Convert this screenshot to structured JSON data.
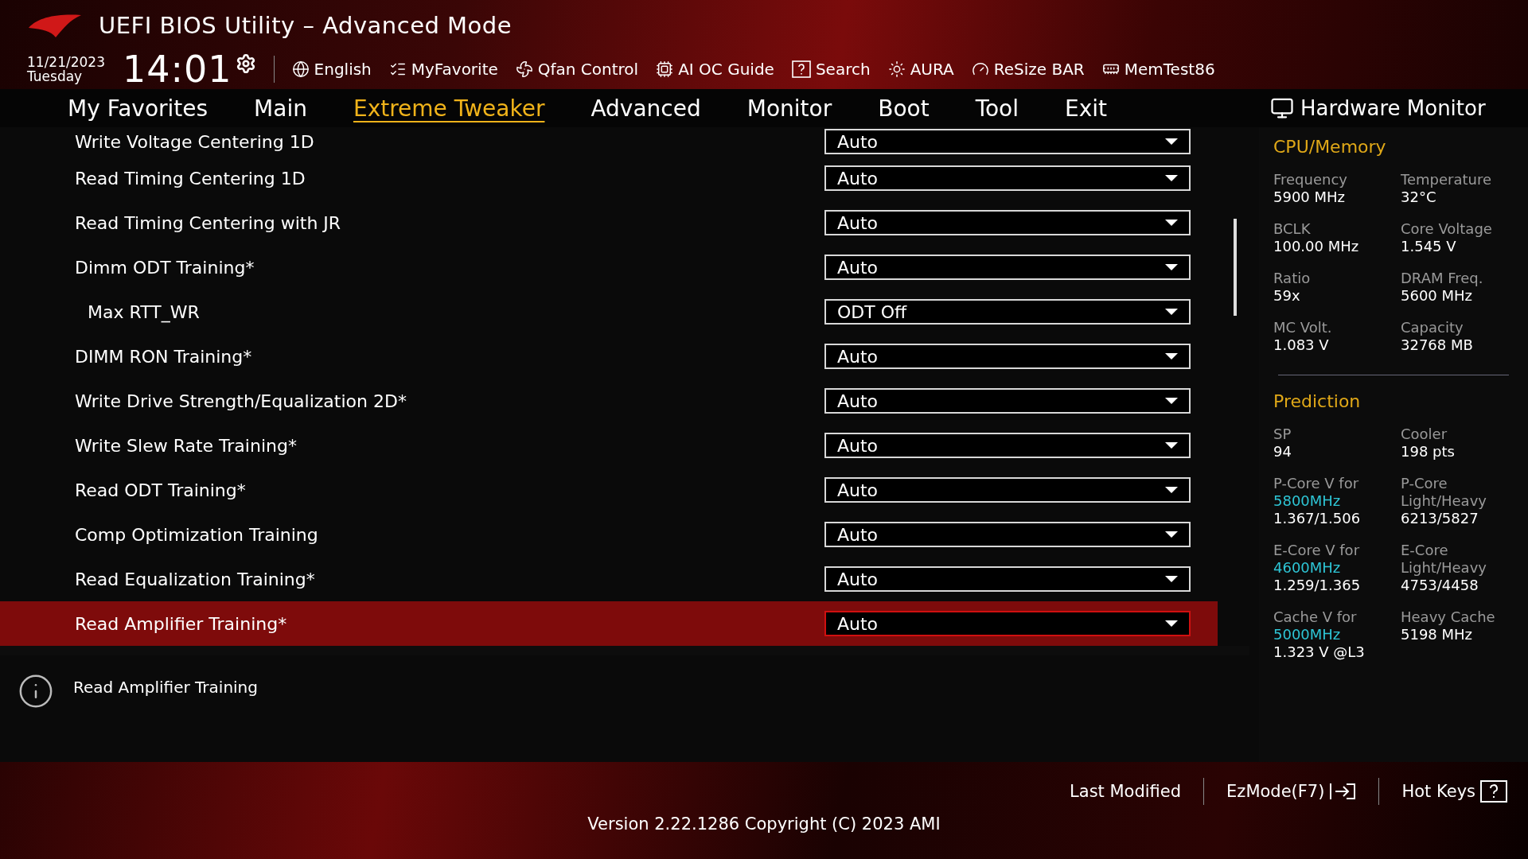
{
  "header": {
    "title": "UEFI BIOS Utility – Advanced Mode",
    "date": "11/21/2023",
    "day": "Tuesday",
    "time": "14:01",
    "tools": [
      {
        "kind": "language",
        "label": "English"
      },
      {
        "kind": "favorite",
        "label": "MyFavorite"
      },
      {
        "kind": "fan",
        "label": "Qfan Control"
      },
      {
        "kind": "guide",
        "label": "AI OC Guide"
      },
      {
        "kind": "search",
        "label": "Search"
      },
      {
        "kind": "aura",
        "label": "AURA"
      },
      {
        "kind": "resize",
        "label": "ReSize BAR"
      },
      {
        "kind": "memtest",
        "label": "MemTest86"
      }
    ]
  },
  "tabs": [
    {
      "label": "My Favorites",
      "selected": false
    },
    {
      "label": "Main",
      "selected": false
    },
    {
      "label": "Extreme Tweaker",
      "selected": true
    },
    {
      "label": "Advanced",
      "selected": false
    },
    {
      "label": "Monitor",
      "selected": false
    },
    {
      "label": "Boot",
      "selected": false
    },
    {
      "label": "Tool",
      "selected": false
    },
    {
      "label": "Exit",
      "selected": false
    }
  ],
  "settings": [
    {
      "label": "Write Voltage Centering 1D",
      "value": "Auto",
      "selected": false
    },
    {
      "label": "Read Timing Centering 1D",
      "value": "Auto",
      "selected": false
    },
    {
      "label": "Read Timing Centering with JR",
      "value": "Auto",
      "selected": false
    },
    {
      "label": "Dimm ODT Training*",
      "value": "Auto",
      "selected": false,
      "children": [
        {
          "label": "Max RTT_WR",
          "value": "ODT Off",
          "selected": false
        }
      ]
    },
    {
      "label": "DIMM RON Training*",
      "value": "Auto",
      "selected": false
    },
    {
      "label": "Write Drive Strength/Equalization 2D*",
      "value": "Auto",
      "selected": false
    },
    {
      "label": "Write Slew Rate Training*",
      "value": "Auto",
      "selected": false
    },
    {
      "label": "Read ODT Training*",
      "value": "Auto",
      "selected": false
    },
    {
      "label": "Comp Optimization Training",
      "value": "Auto",
      "selected": false
    },
    {
      "label": "Read Equalization Training*",
      "value": "Auto",
      "selected": false
    },
    {
      "label": "Read Amplifier Training*",
      "value": "Auto",
      "selected": true
    }
  ],
  "help": {
    "text": "Read Amplifier Training"
  },
  "hardware_monitor": {
    "title": "Hardware Monitor",
    "sections": [
      {
        "title": "CPU/Memory",
        "items": [
          {
            "label": "Frequency",
            "value": "5900 MHz"
          },
          {
            "label": "Temperature",
            "value": "32°C"
          },
          {
            "label": "BCLK",
            "value": "100.00 MHz"
          },
          {
            "label": "Core Voltage",
            "value": "1.545 V"
          },
          {
            "label": "Ratio",
            "value": "59x"
          },
          {
            "label": "DRAM Freq.",
            "value": "5600 MHz"
          },
          {
            "label": "MC Volt.",
            "value": "1.083 V"
          },
          {
            "label": "Capacity",
            "value": "32768 MB"
          }
        ]
      },
      {
        "title": "Prediction",
        "items": [
          {
            "label": "SP",
            "value": "94"
          },
          {
            "label": "Cooler",
            "value": "198 pts"
          },
          {
            "label": "P-Core V for",
            "highlight": "5800MHz",
            "value": "1.367/1.506"
          },
          {
            "label": "P-Core Light/Heavy",
            "value": "6213/5827"
          },
          {
            "label": "E-Core V for",
            "highlight": "4600MHz",
            "value": "1.259/1.365"
          },
          {
            "label": "E-Core Light/Heavy",
            "value": "4753/4458"
          },
          {
            "label": "Cache V for",
            "highlight": "5000MHz",
            "value": "1.323 V @L3"
          },
          {
            "label": "Heavy Cache",
            "value": "5198 MHz"
          }
        ]
      }
    ]
  },
  "footer": {
    "buttons": [
      {
        "kind": "last",
        "label": "Last Modified"
      },
      {
        "kind": "ezmode",
        "label": "EzMode(F7)"
      },
      {
        "kind": "hotkeys",
        "label": "Hot Keys"
      }
    ],
    "version": "Version 2.22.1286 Copyright (C) 2023 AMI"
  }
}
